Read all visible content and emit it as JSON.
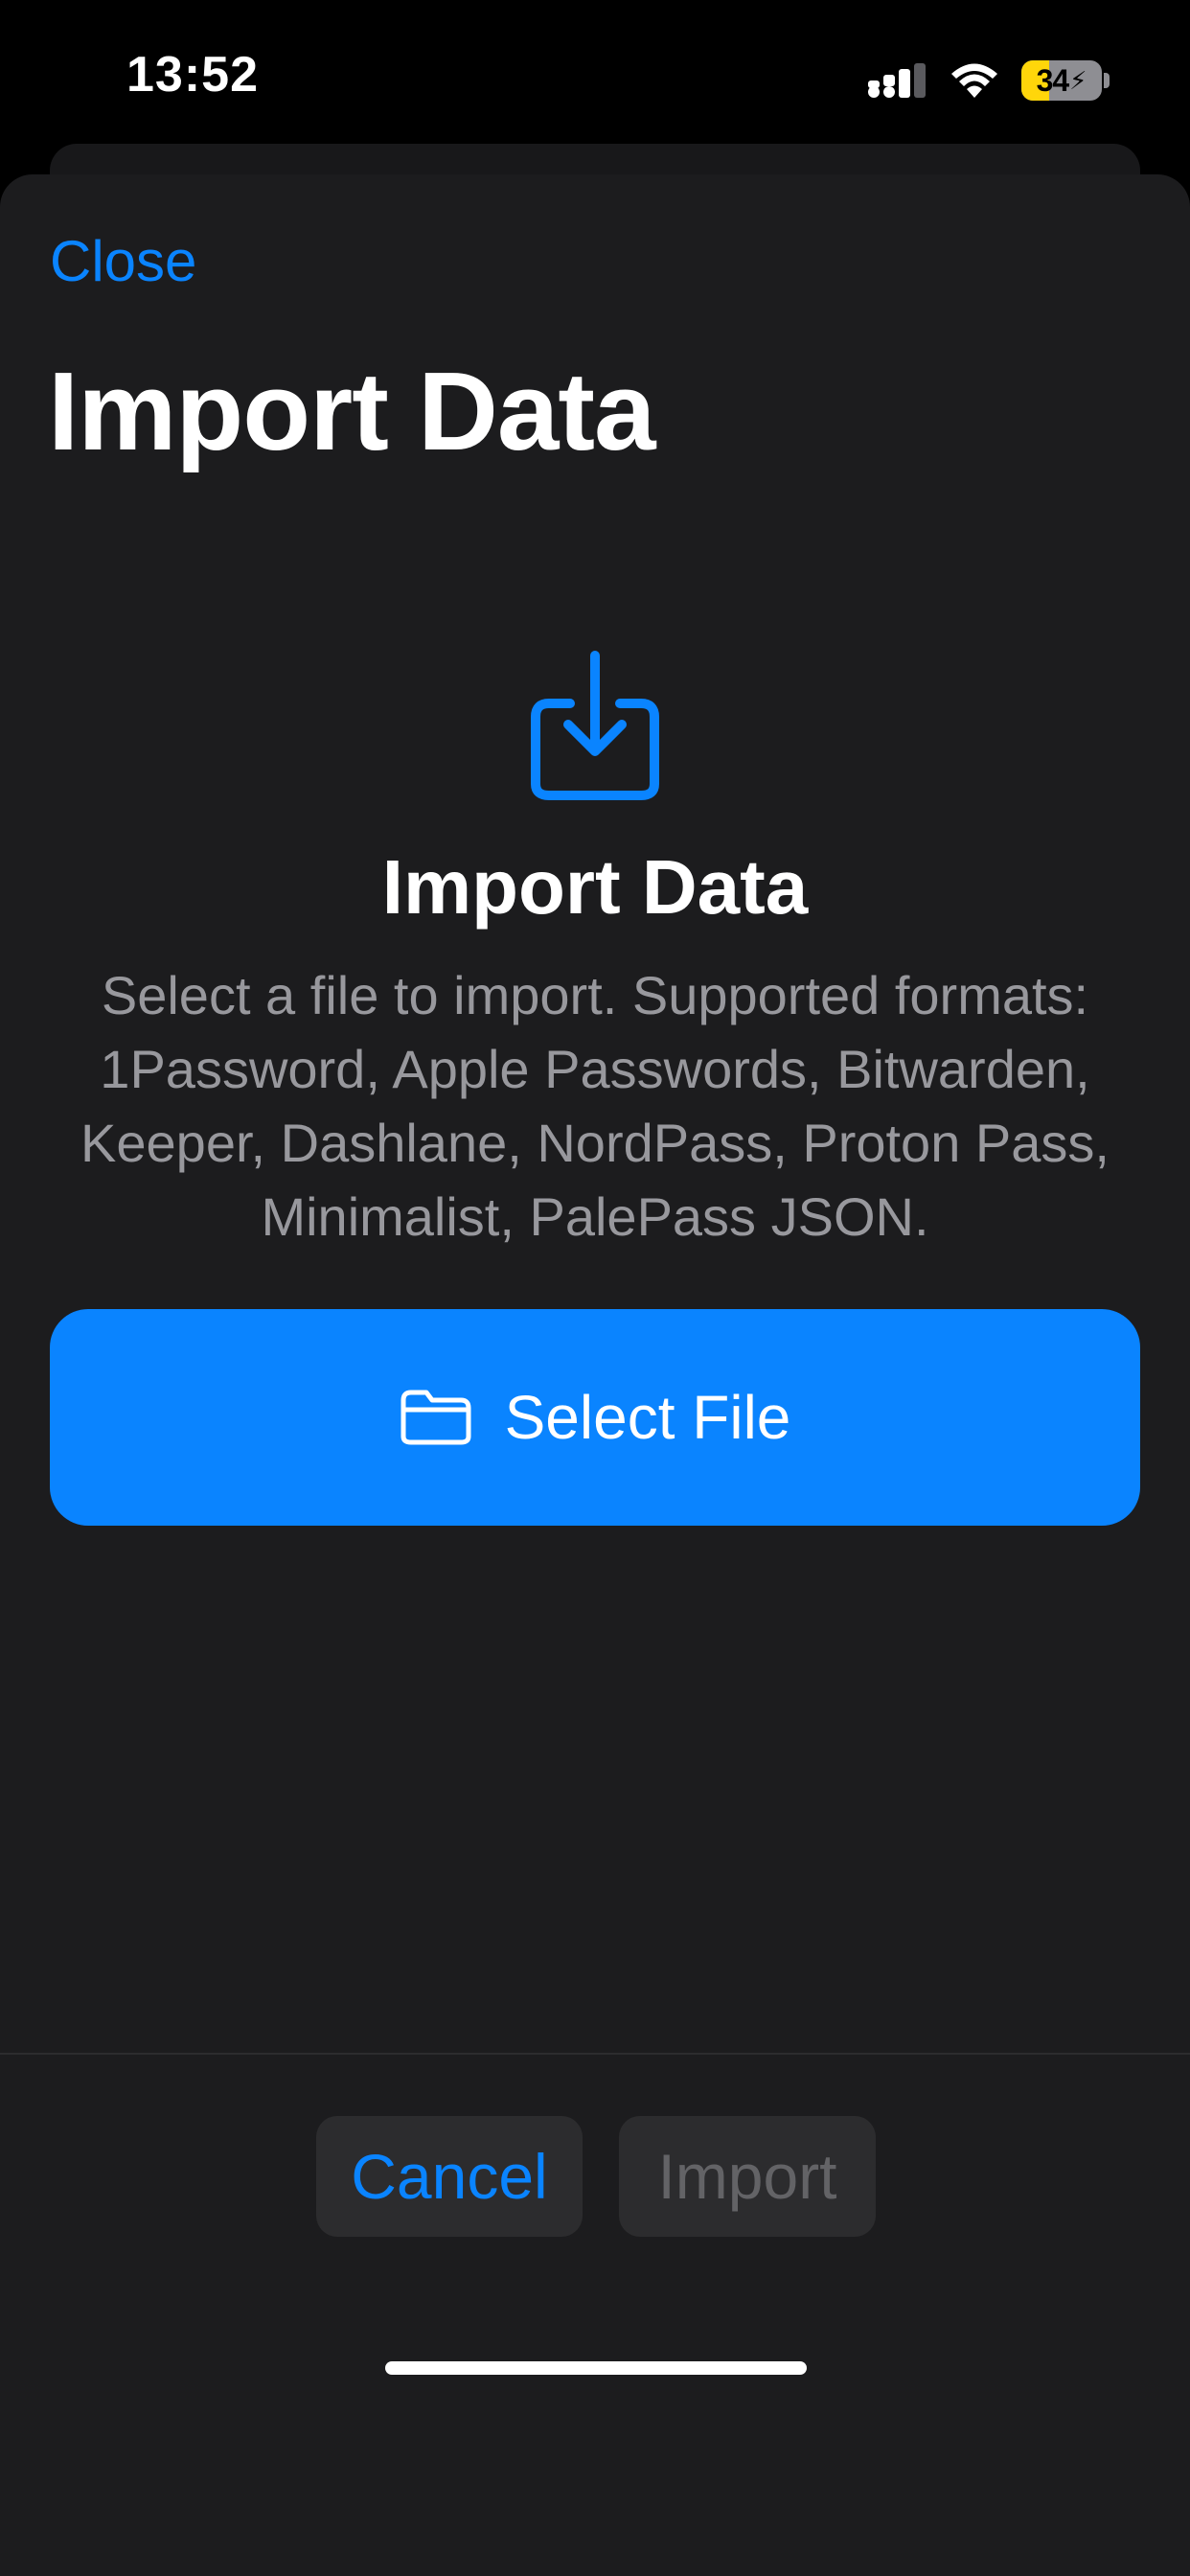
{
  "status_bar": {
    "time": "13:52",
    "battery_level": "34",
    "battery_fraction": 0.34,
    "icons": [
      "cellular-signal-icon",
      "wifi-icon",
      "battery-charging-icon"
    ]
  },
  "sheet": {
    "close_label": "Close",
    "nav_title": "Import Data"
  },
  "hero": {
    "icon": "tray-arrow-down-icon",
    "title": "Import Data",
    "description": "Select a file to import. Supported formats: 1Password, Apple Passwords, Bitwarden, Keeper, Dashlane, NordPass, Proton Pass, Minimalist, PalePass JSON."
  },
  "select_file": {
    "icon": "folder-icon",
    "label": "Select File"
  },
  "toolbar": {
    "cancel_label": "Cancel",
    "import_label": "Import",
    "import_enabled": false
  },
  "colors": {
    "accent": "#0a84ff",
    "sheet_background": "#1c1c1e",
    "secondary_text": "#98989d",
    "disabled_text": "#636366",
    "battery_fill": "#ffd60a"
  }
}
